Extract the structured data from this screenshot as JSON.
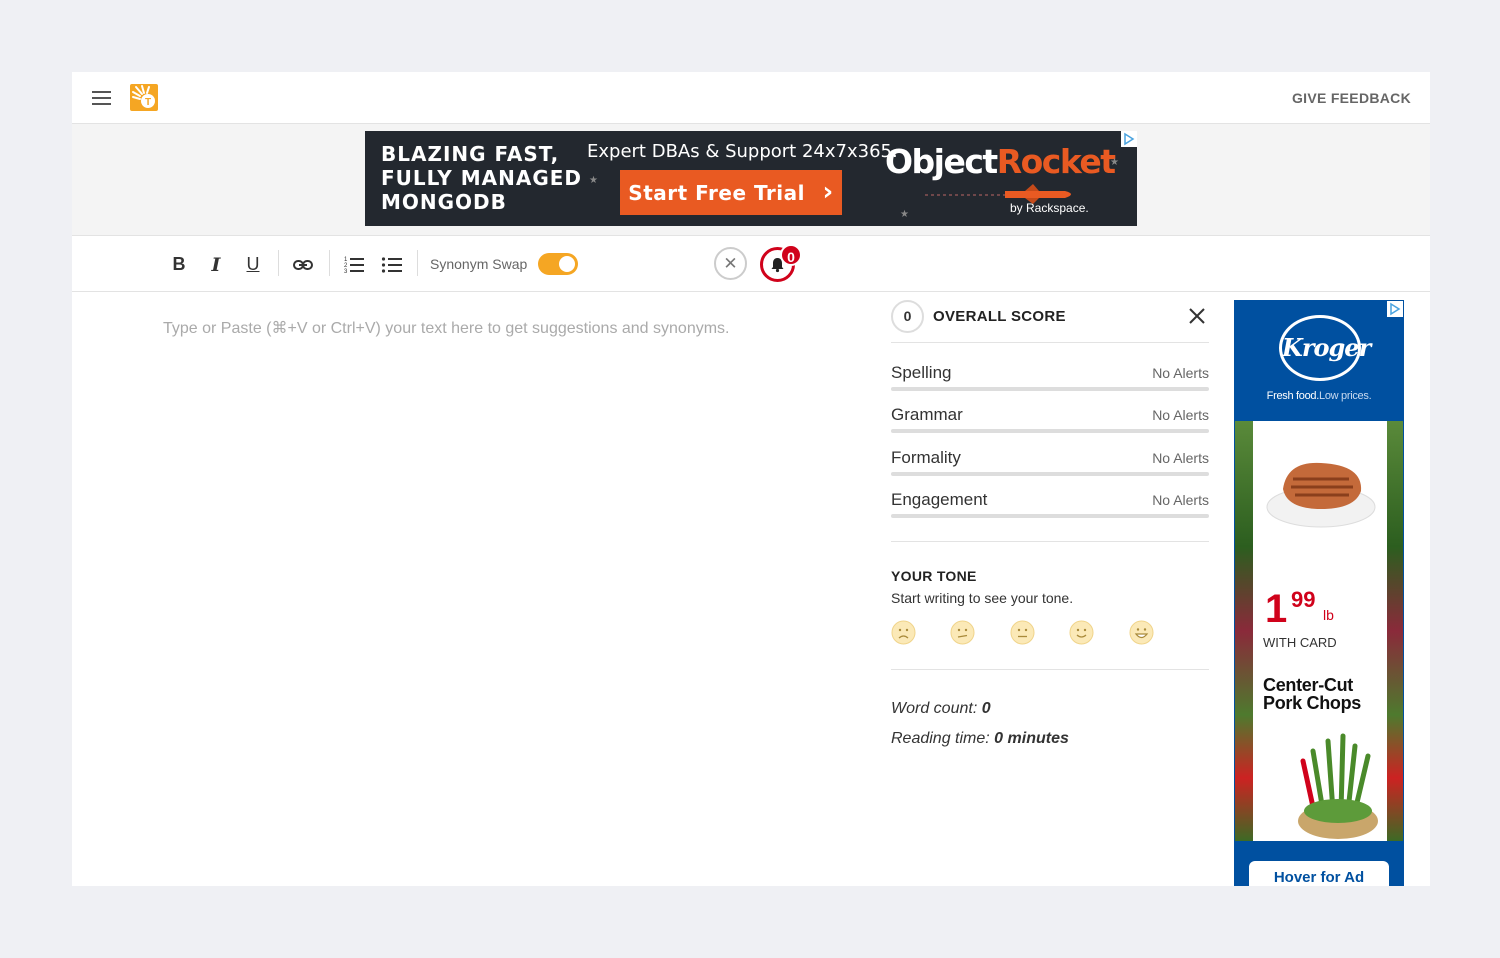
{
  "header": {
    "feedback_label": "GIVE FEEDBACK",
    "logo_letter": "T"
  },
  "banner_ad": {
    "headline_lines": [
      "BLAZING FAST,",
      "FULLY MANAGED",
      "MONGODB"
    ],
    "tagline": "Expert DBAs & Support 24x7x365.",
    "cta_label": "Start Free Trial",
    "cta_arrow": "›",
    "brand_part1": "Object",
    "brand_part2": "Rocket",
    "by_line": "by Rackspace."
  },
  "toolbar": {
    "bold": "B",
    "italic": "I",
    "underline": "U",
    "synonym_label": "Synonym Swap",
    "synonym_enabled": true,
    "clear_symbol": "✕",
    "alert_count": "0"
  },
  "editor": {
    "placeholder": "Type or Paste (⌘+V or Ctrl+V) your text here to get suggestions and synonyms."
  },
  "score_panel": {
    "score": "0",
    "title": "OVERALL SCORE",
    "categories": [
      {
        "name": "Spelling",
        "value": "No Alerts"
      },
      {
        "name": "Grammar",
        "value": "No Alerts"
      },
      {
        "name": "Formality",
        "value": "No Alerts"
      },
      {
        "name": "Engagement",
        "value": "No Alerts"
      }
    ],
    "tone_title": "YOUR TONE",
    "tone_subtitle": "Start writing to see your tone.",
    "word_count_label": "Word count: ",
    "word_count_value": "0",
    "reading_time_label": "Reading time: ",
    "reading_time_value": "0 minutes"
  },
  "side_ad": {
    "brand": "Kroger",
    "tagline_1": "Fresh food.",
    "tagline_2": "Low prices.",
    "price_dollars": "1",
    "price_cents": "99",
    "price_unit": "lb",
    "with_card": "WITH CARD",
    "product_line1": "Center-Cut",
    "product_line2": "Pork Chops",
    "hover_label": "Hover for Ad"
  },
  "colors": {
    "accent_orange": "#f5a623",
    "alert_red": "#d0021b",
    "ad_orange": "#e95a22",
    "kroger_blue": "#0050a0"
  }
}
